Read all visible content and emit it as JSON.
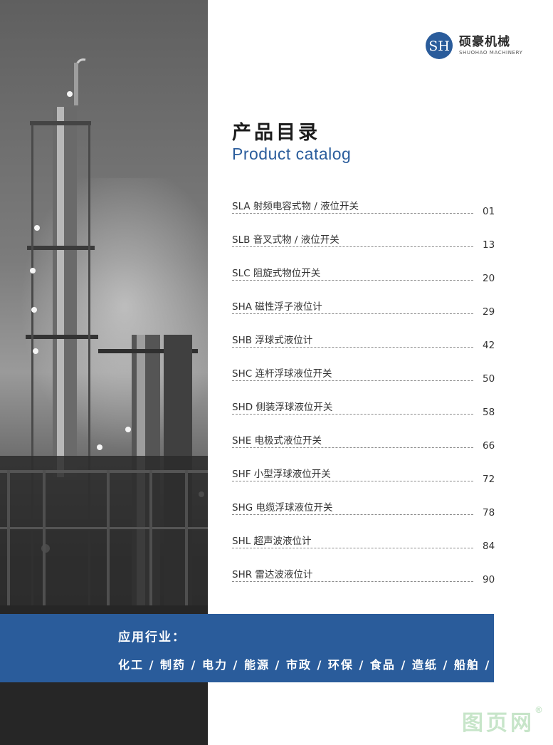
{
  "logo": {
    "name_cn": "硕豪机械",
    "name_en": "SHUOHAO MACHINERY",
    "mark_text": "SH"
  },
  "title": {
    "cn": "产品目录",
    "en": "Product catalog"
  },
  "toc": [
    {
      "label": "SLA 射频电容式物 / 液位开关",
      "page": "01"
    },
    {
      "label": "SLB 音叉式物 / 液位开关",
      "page": "13"
    },
    {
      "label": "SLC 阻旋式物位开关",
      "page": "20"
    },
    {
      "label": "SHA 磁性浮子液位计",
      "page": "29"
    },
    {
      "label": "SHB 浮球式液位计",
      "page": "42"
    },
    {
      "label": "SHC 连杆浮球液位开关",
      "page": "50"
    },
    {
      "label": "SHD 侧装浮球液位开关",
      "page": "58"
    },
    {
      "label": "SHE 电极式液位开关",
      "page": "66"
    },
    {
      "label": "SHF 小型浮球液位开关",
      "page": "72"
    },
    {
      "label": "SHG 电缆浮球液位开关",
      "page": "78"
    },
    {
      "label": "SHL 超声波液位计",
      "page": "84"
    },
    {
      "label": "SHR 雷达波液位计",
      "page": "90"
    }
  ],
  "industries": {
    "title": "应用行业：",
    "list": "化工 / 制药 / 电力 / 能源 / 市政 / 环保 / 食品 / 造纸 / 船舶 / 冶金"
  },
  "watermark": {
    "text": "图页网",
    "mark": "®"
  },
  "colors": {
    "accent": "#2a5c9b",
    "photo_dark": "#2a2a2a"
  }
}
